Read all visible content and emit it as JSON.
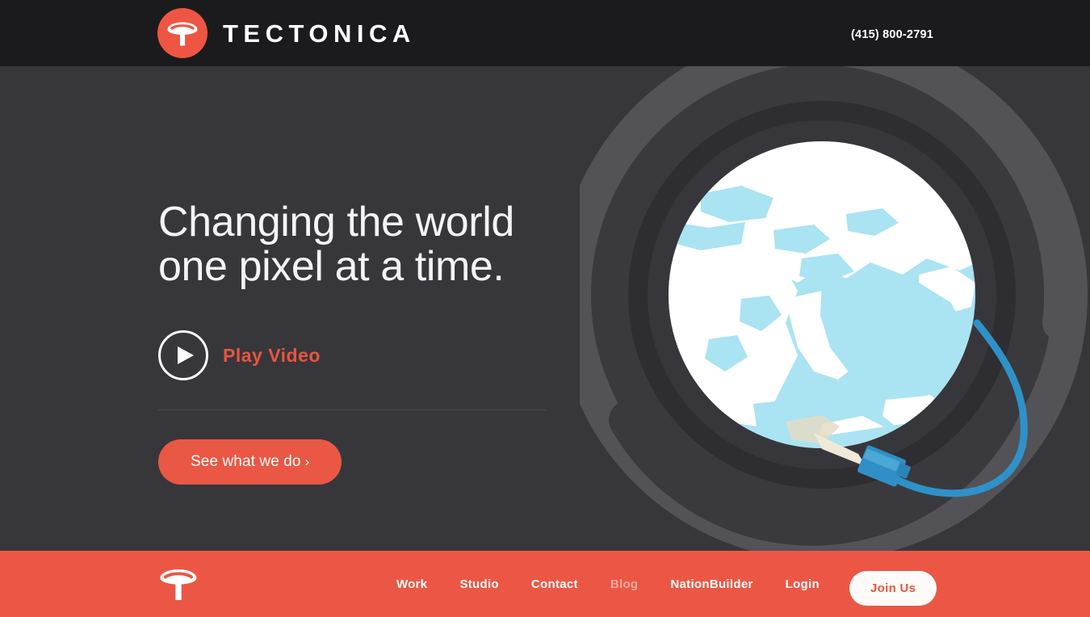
{
  "header": {
    "logo_icon": "tectonica-t-mark-icon",
    "brand_name": "TECTONICA",
    "phone": "(415) 800-2791"
  },
  "hero": {
    "headline_line1": "Changing the world",
    "headline_line2": "one pixel at a time.",
    "play_icon": "play-triangle-icon",
    "play_label": "Play Video",
    "cta_label": "See what we do",
    "cta_chevron": "›",
    "illustration": "globe-with-network-cable-illustration"
  },
  "footer": {
    "logo_icon": "tectonica-t-mark-icon",
    "nav": [
      {
        "label": "Work",
        "state": "default"
      },
      {
        "label": "Studio",
        "state": "default"
      },
      {
        "label": "Contact",
        "state": "default"
      },
      {
        "label": "Blog",
        "state": "dimmed"
      },
      {
        "label": "NationBuilder",
        "state": "default"
      },
      {
        "label": "Login",
        "state": "default"
      }
    ],
    "join_label": "Join Us"
  },
  "colors": {
    "brand_red": "#eb5744",
    "header_bg": "#1b1b1d",
    "hero_bg": "#37373b",
    "ring_dark": "#2e2e32",
    "ring_light": "#525257",
    "globe_ocean": "#aae3f2",
    "globe_land": "#ffffff",
    "cable_blue": "#2e92c9",
    "text_light": "#f4f4f4"
  }
}
